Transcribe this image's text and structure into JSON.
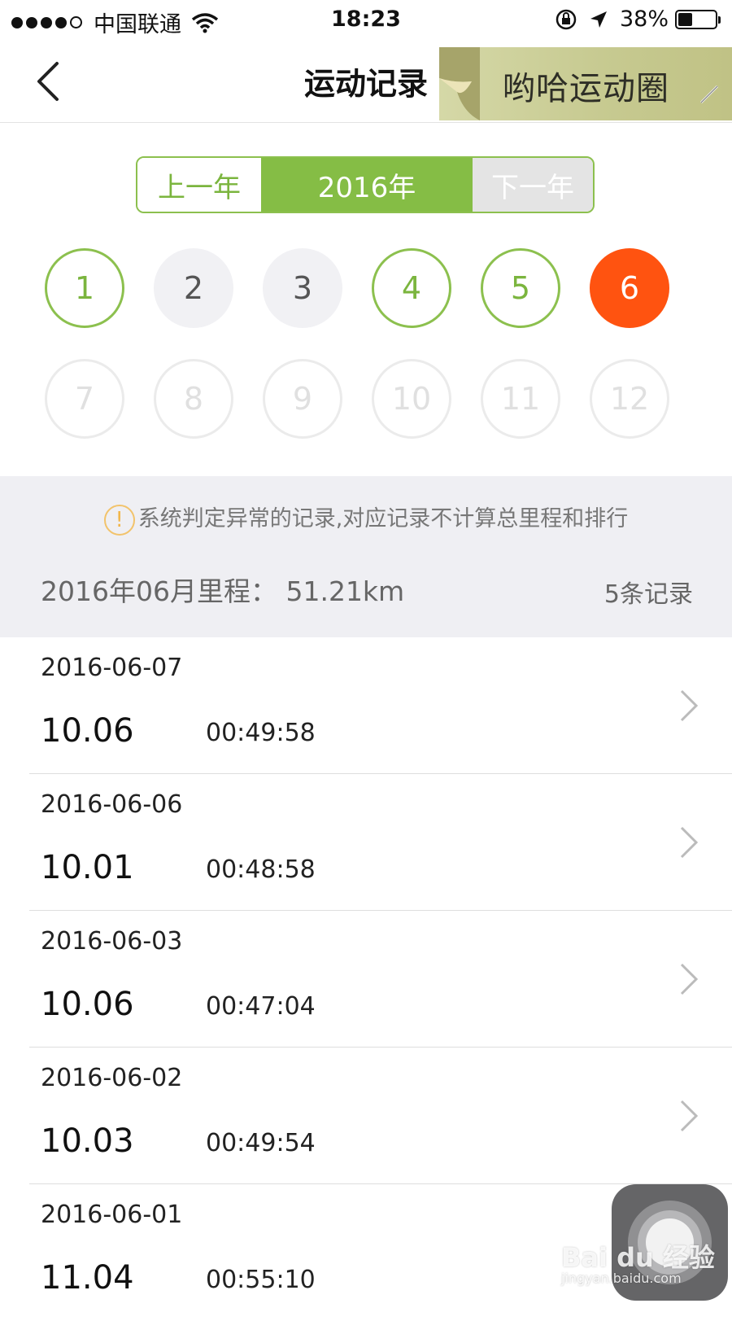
{
  "status_bar": {
    "carrier": "中国联通",
    "time": "18:23",
    "battery": "38%",
    "battery_level": 0.38,
    "icons": [
      "signal-dots-icon",
      "wifi-icon",
      "rotation-lock-icon",
      "location-arrow-icon",
      "battery-icon"
    ]
  },
  "nav": {
    "title": "运动记录",
    "back_icon": "chevron-left-icon",
    "ad_text": "哟哈运动圈"
  },
  "year_switch": {
    "prev": "上一年",
    "current": "2016年",
    "next": "下一年"
  },
  "months": [
    {
      "label": "1",
      "state": "has"
    },
    {
      "label": "2",
      "state": "none"
    },
    {
      "label": "3",
      "state": "none"
    },
    {
      "label": "4",
      "state": "has"
    },
    {
      "label": "5",
      "state": "has"
    },
    {
      "label": "6",
      "state": "active"
    },
    {
      "label": "7",
      "state": "future"
    },
    {
      "label": "8",
      "state": "future"
    },
    {
      "label": "9",
      "state": "future"
    },
    {
      "label": "10",
      "state": "future"
    },
    {
      "label": "11",
      "state": "future"
    },
    {
      "label": "12",
      "state": "future"
    }
  ],
  "summary": {
    "warn_symbol": "!",
    "notice": "系统判定异常的记录,对应记录不计算总里程和排行",
    "month_total": "2016年06月里程：  51.21km",
    "count": "5条记录"
  },
  "records": [
    {
      "date": "2016-06-07",
      "distance": "10.06",
      "duration": "00:49:58"
    },
    {
      "date": "2016-06-06",
      "distance": "10.01",
      "duration": "00:48:58"
    },
    {
      "date": "2016-06-03",
      "distance": "10.06",
      "duration": "00:47:04"
    },
    {
      "date": "2016-06-02",
      "distance": "10.03",
      "duration": "00:49:54"
    },
    {
      "date": "2016-06-01",
      "distance": "11.04",
      "duration": "00:55:10"
    }
  ],
  "watermark": {
    "main": "Bai du 经验",
    "sub": "jingyan.baidu.com"
  },
  "colors": {
    "green": "#85bd45",
    "orange": "#ff5310",
    "gray_bg": "#efeff3"
  }
}
